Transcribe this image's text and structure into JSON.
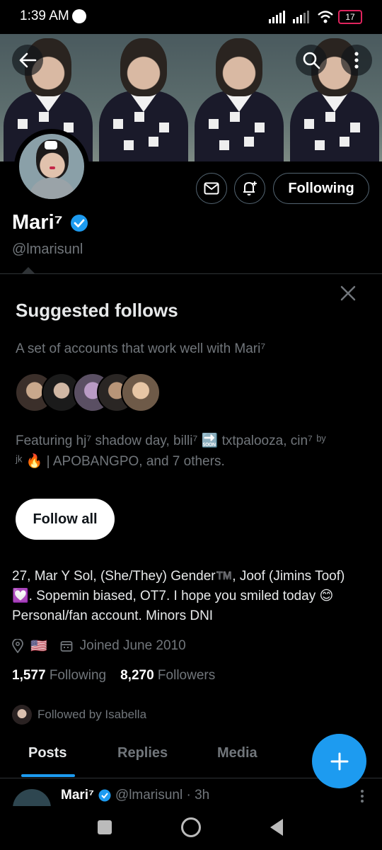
{
  "status_bar": {
    "time": "1:39 AM",
    "battery": "17"
  },
  "profile": {
    "display_name": "Mari⁷",
    "handle": "@lmarisunl",
    "following_button": "Following",
    "bio_line1": "27, Mar Y Sol, (She/They) Gender™️, Joof (Jimins Toof)",
    "bio_line2": "💟. Sopemin biased, OT7. I hope you smiled today 😊",
    "bio_line3": "Personal/fan account. Minors DNI",
    "location_flag": "🇺🇸",
    "joined": "Joined June 2010",
    "following_count": "1,577",
    "following_label": "Following",
    "followers_count": "8,270",
    "followers_label": "Followers",
    "followed_by": "Followed by Isabella"
  },
  "suggested": {
    "title": "Suggested follows",
    "subtitle": "A set of accounts that work well with Mari⁷",
    "featuring_line1": "Featuring hj⁷ shadow day, billi⁷ 🔜 txtpalooza, cin⁷ ᵇʸ",
    "featuring_line2": "ʲᵏ 🔥 | APOBANGPO, and 7 others.",
    "follow_all": "Follow all"
  },
  "tabs": {
    "posts": "Posts",
    "replies": "Replies",
    "media": "Media"
  },
  "post_preview": {
    "name": "Mari⁷",
    "handle_time": "@lmarisunl · 3h"
  },
  "colors": {
    "accent": "#1d9bf0",
    "background": "#000000",
    "muted": "#71767b"
  }
}
